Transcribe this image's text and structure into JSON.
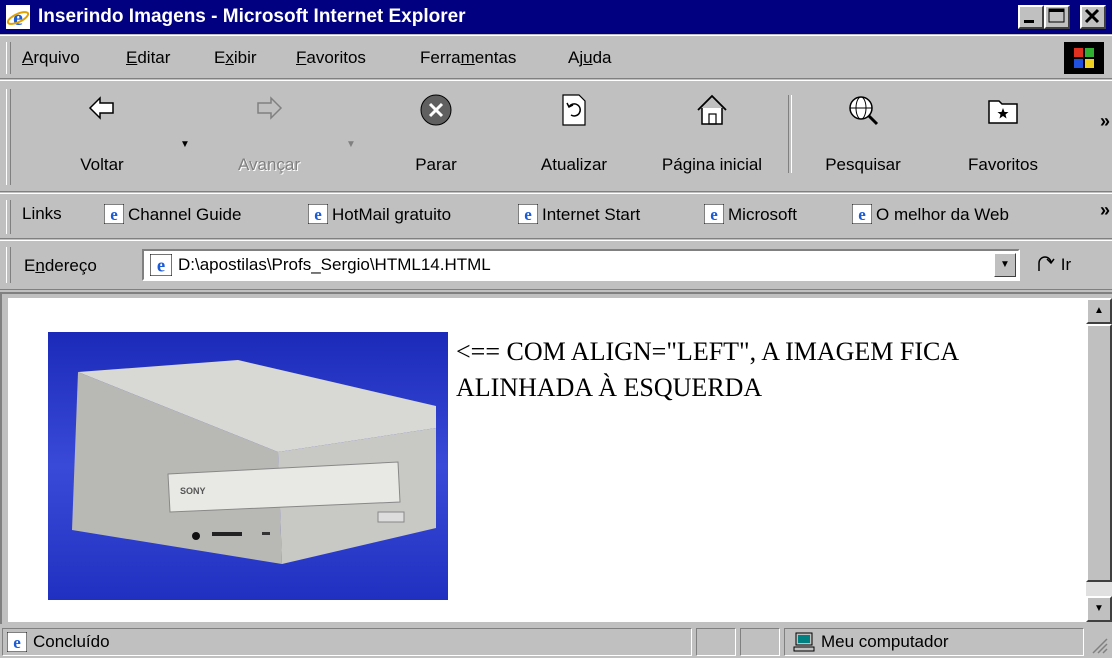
{
  "window": {
    "title": "Inserindo Imagens - Microsoft Internet Explorer",
    "controls": {
      "minimize": "minimize",
      "maximize": "maximize",
      "close": "close"
    }
  },
  "menu": {
    "items": [
      {
        "mnemonic": "A",
        "rest": "rquivo"
      },
      {
        "mnemonic": "E",
        "rest": "ditar"
      },
      {
        "pre": "E",
        "mnemonic": "x",
        "rest": "ibir"
      },
      {
        "mnemonic": "F",
        "rest": "avoritos"
      },
      {
        "pre": "Ferra",
        "mnemonic": "m",
        "rest": "entas"
      },
      {
        "pre": "Aj",
        "mnemonic": "u",
        "rest": "da"
      }
    ]
  },
  "toolbar": {
    "back": "Voltar",
    "forward": "Avançar",
    "stop": "Parar",
    "refresh": "Atualizar",
    "home": "Página inicial",
    "search": "Pesquisar",
    "favorites": "Favoritos",
    "more": "»"
  },
  "links": {
    "label": "Links",
    "items": [
      "Channel Guide",
      "HotMail gratuito",
      "Internet Start",
      "Microsoft",
      "O melhor da Web"
    ],
    "more": "»"
  },
  "address": {
    "label_pre": "E",
    "label_mnemonic": "n",
    "label_rest": "dereço",
    "value": "D:\\apostilas\\Profs_Sergio\\HTML14.HTML",
    "go": "Ir"
  },
  "page": {
    "image_alt": "SONY",
    "text_line1": "<== COM ALIGN=\"LEFT\", A IMAGEM FICA",
    "text_line2": "ALINHADA À ESQUERDA"
  },
  "status": {
    "text": "Concluído",
    "zone": "Meu computador"
  },
  "colors": {
    "titlebar": "#000080",
    "chrome": "#c0c0c0",
    "image_background": "#2f3fc8"
  }
}
